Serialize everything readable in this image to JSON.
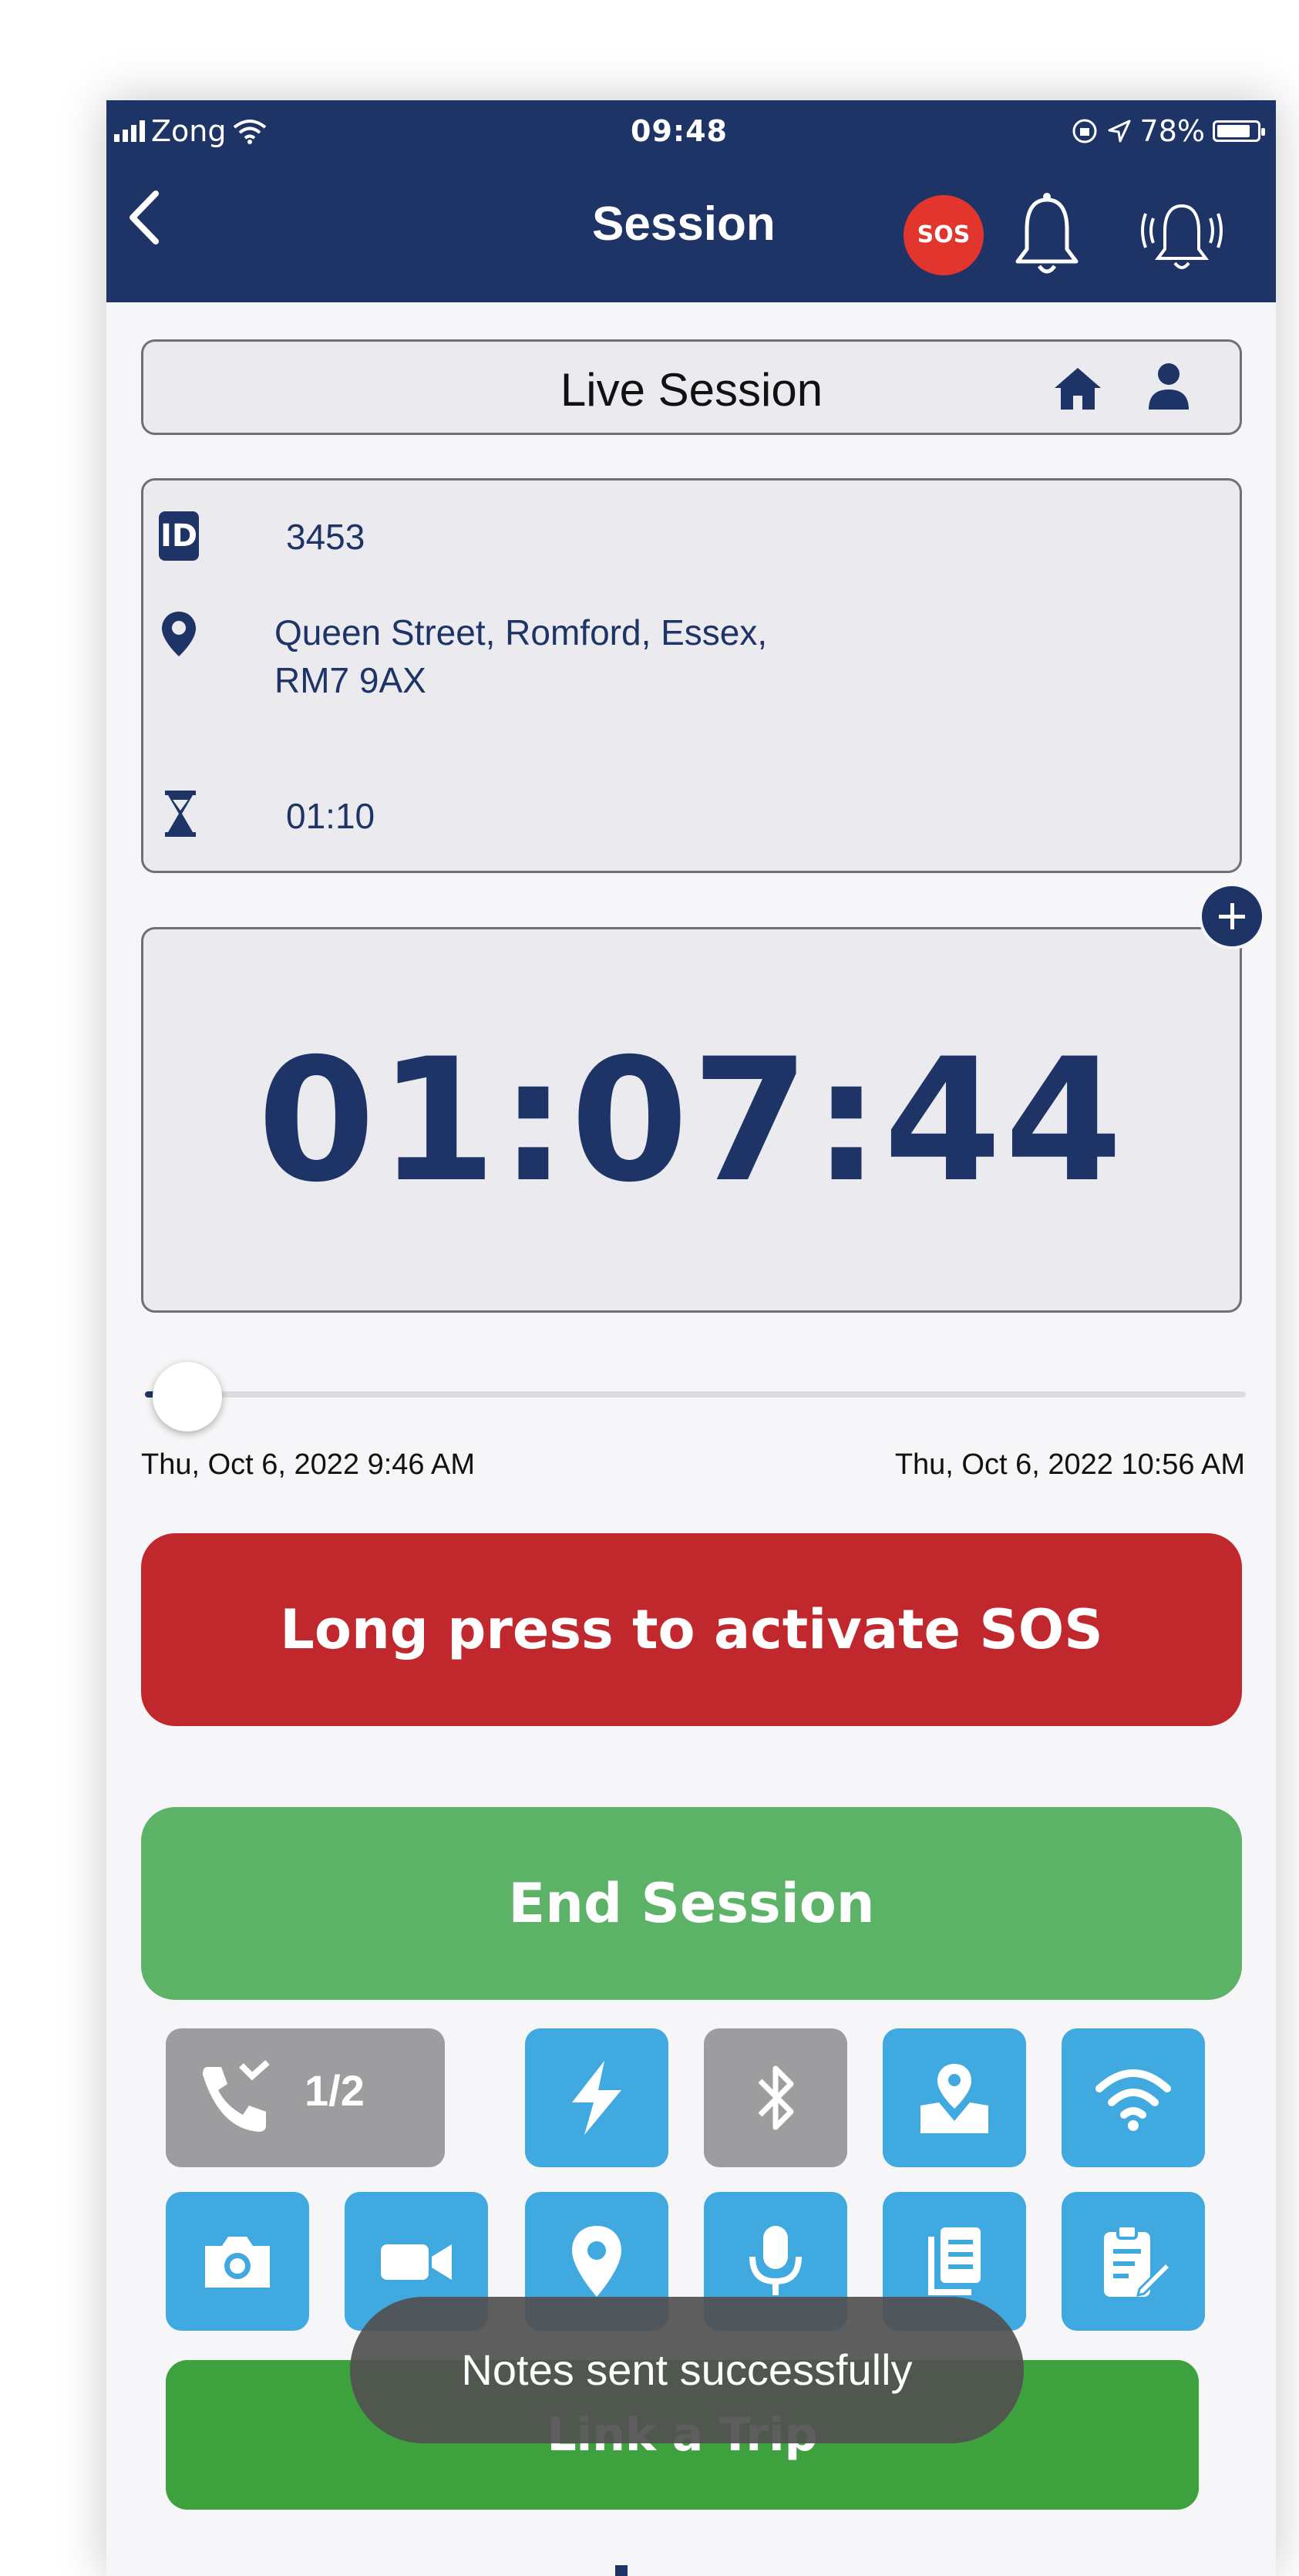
{
  "status_bar": {
    "carrier": "Zong",
    "time": "09:48",
    "battery": "78%"
  },
  "nav": {
    "title": "Session",
    "sos_badge": "SOS"
  },
  "live_session": {
    "title": "Live Session"
  },
  "session_info": {
    "id": "3453",
    "address_line1": "Queen Street, Romford, Essex,",
    "address_line2": "RM7 9AX",
    "duration": "01:10"
  },
  "timer": {
    "value": "01:07:44"
  },
  "slider": {
    "progress": 0.02,
    "start_label": "Thu, Oct 6, 2022 9:46 AM",
    "end_label": "Thu, Oct 6, 2022 10:56 AM"
  },
  "buttons": {
    "sos": "Long press to activate SOS",
    "end_session": "End Session",
    "link_trip": "Link a Trip"
  },
  "tiles": {
    "call_count": "1/2"
  },
  "toast": {
    "message": "Notes sent successfully"
  },
  "colors": {
    "navy": "#1e3466",
    "sos_red": "#c1282d",
    "end_green": "#5cb266",
    "tile_blue": "#3fa9e0",
    "tile_gray": "#9d9da0",
    "link_green": "#3da23d"
  }
}
